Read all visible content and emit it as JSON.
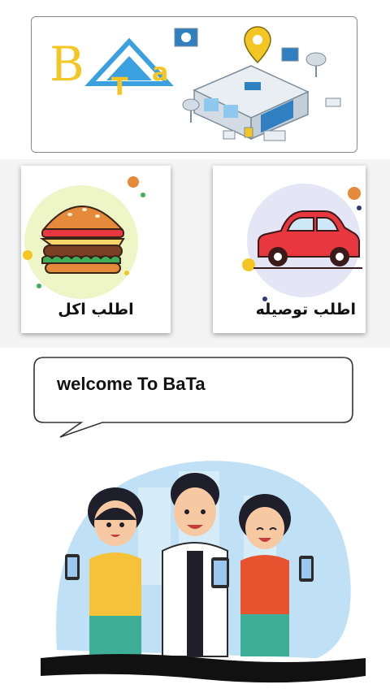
{
  "logo": {
    "letters": [
      "B",
      "T",
      "a"
    ],
    "brand_color": "#f3c623",
    "accent_color": "#3aa0e0"
  },
  "cards": {
    "food": {
      "label": "اطلب اكل",
      "icon": "burger-icon"
    },
    "ride": {
      "label": "اطلب توصيله",
      "icon": "car-icon"
    }
  },
  "welcome": {
    "text": "welcome To BaTa"
  },
  "colors": {
    "car_red": "#e8373f",
    "burger_bun": "#e58a3a",
    "lettuce": "#3fae5b",
    "illustration_blue": "#bfe0f5"
  }
}
